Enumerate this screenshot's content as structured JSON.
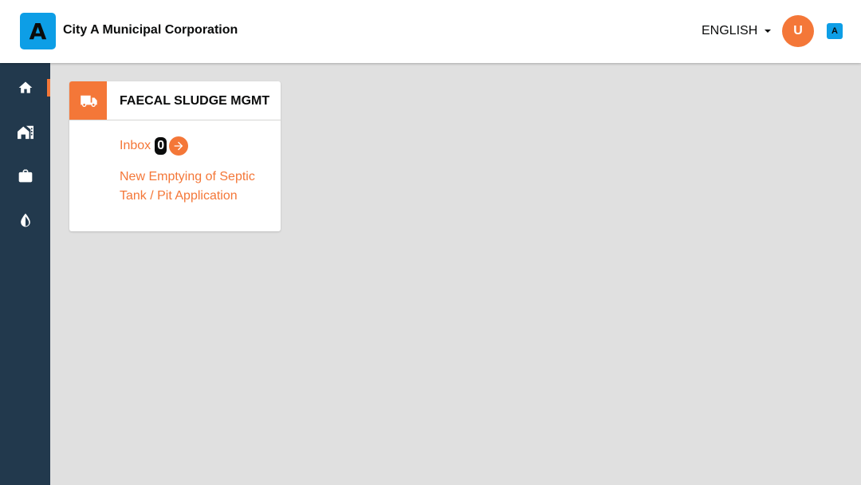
{
  "header": {
    "logo_letter": "A",
    "city_name": "City A Municipal Corporation",
    "language": "ENGLISH",
    "avatar_initial": "U",
    "mini_logo_letter": "A"
  },
  "sidebar": {
    "items": [
      {
        "icon": "home-icon",
        "active": true
      },
      {
        "icon": "property-icon",
        "active": false
      },
      {
        "icon": "briefcase-icon",
        "active": false
      },
      {
        "icon": "water-drop-icon",
        "active": false
      }
    ]
  },
  "card": {
    "icon": "truck-icon",
    "title": "FAECAL SLUDGE MGMT",
    "inbox_label": "Inbox",
    "inbox_count": "0",
    "new_application_label": "New Emptying of Septic Tank / Pit Application"
  },
  "colors": {
    "accent": "#f47738",
    "sidebar": "#22394d",
    "brand": "#0d9ee6",
    "background": "#e0e0e0"
  }
}
